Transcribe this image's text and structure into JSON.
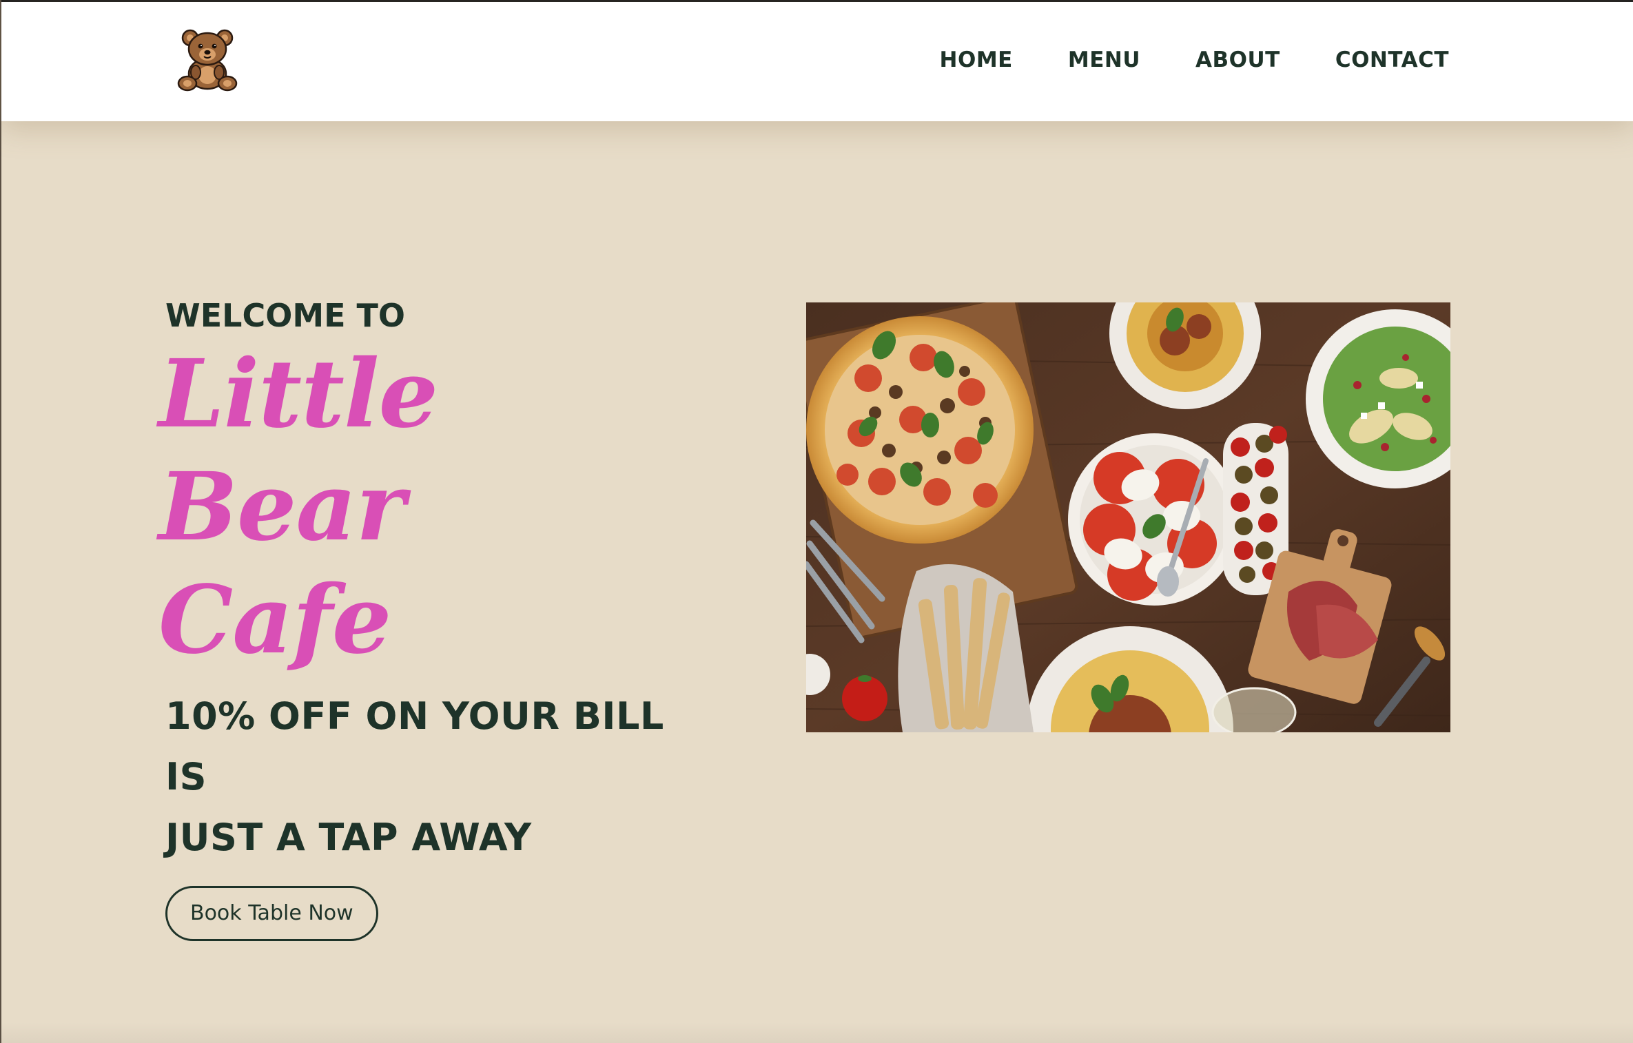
{
  "nav": {
    "logo_icon": "teddy-bear-icon",
    "links": [
      "HOME",
      "MENU",
      "ABOUT",
      "CONTACT"
    ]
  },
  "hero": {
    "welcome": "WELCOME TO",
    "brand_line1": "Little Bear",
    "brand_line2": "Cafe",
    "offer_line1": "10% OFF ON YOUR BILL IS",
    "offer_line2": "JUST A TAP AWAY",
    "cta_label": "Book Table Now",
    "image_icon": "food-spread-photo"
  },
  "colors": {
    "background": "#e7dcc8",
    "header": "#ffffff",
    "text_dark": "#1e3329",
    "brand_pink": "#d94fb6"
  }
}
